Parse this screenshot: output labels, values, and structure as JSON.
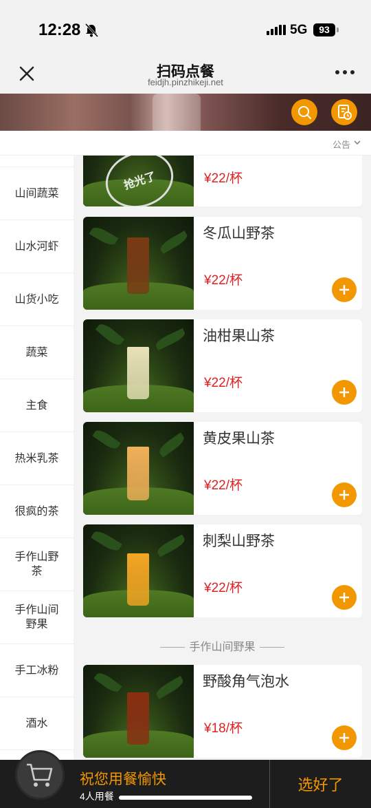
{
  "status": {
    "time": "12:28",
    "network": "5G",
    "battery": "93"
  },
  "nav": {
    "title": "扫码点餐",
    "url": "feidjh.pinzhikeji.net"
  },
  "notice": {
    "label": "公告"
  },
  "sidebar": {
    "items": [
      {
        "label": "山间蔬菜"
      },
      {
        "label": "山水河虾"
      },
      {
        "label": "山货小吃"
      },
      {
        "label": "蔬菜"
      },
      {
        "label": "主食"
      },
      {
        "label": "热米乳茶"
      },
      {
        "label": "很疯的茶"
      },
      {
        "label": "手作山野茶"
      },
      {
        "label": "手作山间野果"
      },
      {
        "label": "手工冰粉"
      },
      {
        "label": "酒水"
      }
    ]
  },
  "products": {
    "soldout_stamp": "抢光了",
    "top_partial": {
      "price": "¥22/杯"
    },
    "items": [
      {
        "name": "冬瓜山野茶",
        "price": "¥22/杯",
        "cup_color": "#7a3a14"
      },
      {
        "name": "油柑果山茶",
        "price": "¥22/杯",
        "cup_color": "#e8e2b8"
      },
      {
        "name": "黄皮果山茶",
        "price": "¥22/杯",
        "cup_color": "#f2b05a"
      },
      {
        "name": "刺梨山野茶",
        "price": "¥22/杯",
        "cup_color": "#f5a623"
      }
    ],
    "section_title": "手作山间野果",
    "section_items": [
      {
        "name": "野酸角气泡水",
        "price": "¥18/杯",
        "cup_color": "#8a2f12"
      }
    ]
  },
  "bottom_bar": {
    "title": "祝您用餐愉快",
    "subtitle": "4人用餐",
    "action": "选好了"
  },
  "colors": {
    "accent": "#f39700",
    "price": "#e02020",
    "bottom_bg": "#1d1d1d"
  }
}
